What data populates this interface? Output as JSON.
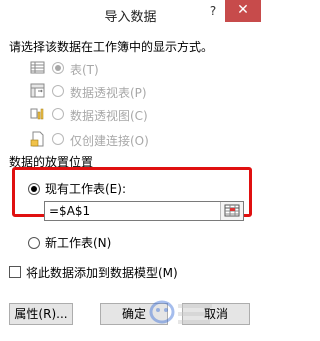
{
  "window": {
    "title": "导入数据",
    "help_glyph": "?",
    "close_glyph": "✕"
  },
  "prompt": "请选择该数据在工作簿中的显示方式。",
  "view_options": [
    {
      "label": "表(T)",
      "selected": true,
      "icon": "table-icon"
    },
    {
      "label": "数据透视表(P)",
      "selected": false,
      "icon": "pivot-table-icon"
    },
    {
      "label": "数据透视图(C)",
      "selected": false,
      "icon": "pivot-chart-icon"
    },
    {
      "label": "仅创建连接(O)",
      "selected": false,
      "icon": "connection-only-icon"
    }
  ],
  "placement": {
    "header": "数据的放置位置",
    "existing_sheet_label": "现有工作表(E):",
    "existing_sheet_selected": true,
    "reference_value": "=$A$1",
    "new_sheet_label": "新工作表(N)",
    "new_sheet_selected": false
  },
  "data_model": {
    "label": "将此数据添加到数据模型(M)",
    "checked": false
  },
  "buttons": {
    "properties": "属性(R)...",
    "ok": "确定",
    "cancel": "取消"
  },
  "colors": {
    "highlight_border": "#e01010",
    "close_button": "#c74b4b"
  }
}
